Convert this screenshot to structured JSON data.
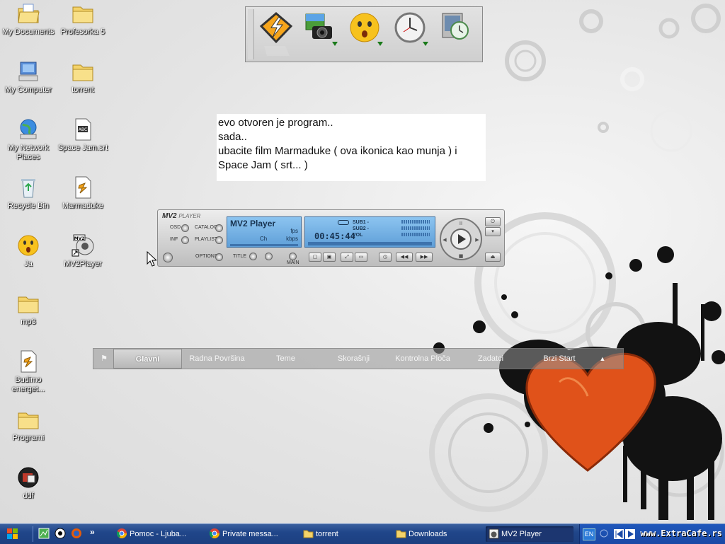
{
  "desktop": {
    "icons": [
      {
        "label": "My Documents",
        "icon": "my-documents-icon"
      },
      {
        "label": "Profesorka 5",
        "icon": "folder-icon"
      },
      {
        "label": "My Computer",
        "icon": "my-computer-icon"
      },
      {
        "label": "torrent",
        "icon": "folder-icon"
      },
      {
        "label": "My Network Places",
        "icon": "network-places-icon"
      },
      {
        "label": "Space Jam.srt",
        "icon": "subtitle-file-icon"
      },
      {
        "label": "Recycle Bin",
        "icon": "recycle-bin-icon"
      },
      {
        "label": "Marmaduke",
        "icon": "video-file-icon"
      },
      {
        "label": "Ja",
        "icon": "smiley-icon"
      },
      {
        "label": "MV2Player",
        "icon": "mv2player-shortcut-icon"
      },
      {
        "label": "mp3",
        "icon": "folder-icon"
      },
      {
        "label": "Budimo energet...",
        "icon": "video-file-icon"
      },
      {
        "label": "Programi",
        "icon": "folder-icon"
      },
      {
        "label": "ddf",
        "icon": "app-icon"
      }
    ]
  },
  "dock": {
    "items": [
      "winamp-lightning-icon",
      "camera-icon",
      "smiley-icon",
      "clock-icon",
      "monitor-clock-icon"
    ]
  },
  "note": {
    "lines": [
      "evo otvoren je program..",
      "sada..",
      "ubacite film Marmaduke ( ova ikonica kao munja ) i",
      "Space Jam ( srt... )"
    ]
  },
  "player": {
    "brand": "MV2",
    "brand_sub": "PLAYER",
    "left_labels": {
      "osd": "OSD",
      "inf": "INF",
      "catalog": "CATALOG",
      "playlist": "PLAYLIST",
      "options": "OPTIONS"
    },
    "title_label": "TITLE",
    "main_label": "MAIN",
    "display_title": "MV2 Player",
    "fps": "fps",
    "ch": "Ch",
    "kbps": "kbps",
    "time": "00:45:44",
    "sub1": "SUB1 -",
    "sub2": "SUB2 -",
    "vol": "VOL"
  },
  "tabbar": {
    "tabs": [
      "Glavni",
      "Radna Površina",
      "Teme",
      "Skorašnji",
      "Kontrolna Ploča",
      "Zadatci",
      "Brzi Start"
    ],
    "active": "Glavni"
  },
  "taskbar": {
    "buttons": [
      {
        "label": "Pomoc - Ljuba...",
        "icon": "chrome-icon",
        "active": false
      },
      {
        "label": "Private messa...",
        "icon": "chrome-icon",
        "active": false
      },
      {
        "label": "torrent",
        "icon": "folder-icon",
        "active": false
      },
      {
        "label": "Downloads",
        "icon": "folder-icon",
        "active": false
      },
      {
        "label": "MV2 Player",
        "icon": "mv2-icon",
        "active": true
      }
    ],
    "language": "EN",
    "watermark": "www.ExtraCafe.rs",
    "chevron": "»"
  },
  "colors": {
    "taskbar": "#20468a",
    "lcd": "#7fb8ec",
    "heart": "#e0521a",
    "splatter": "#111111"
  }
}
